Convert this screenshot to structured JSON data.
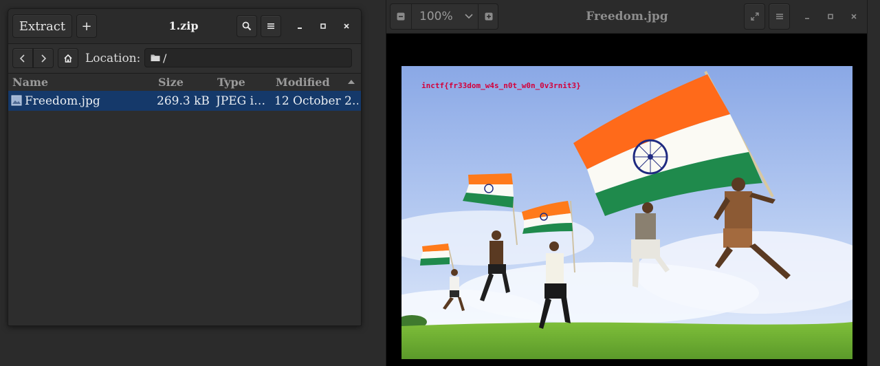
{
  "archive": {
    "title": "1.zip",
    "extract_label": "Extract",
    "add_label": "+",
    "location_label": "Location:",
    "location_path": "/",
    "columns": [
      "Name",
      "Size",
      "Type",
      "Modified"
    ],
    "files": [
      {
        "name": "Freedom.jpg",
        "size": "269.3 kB",
        "type": "JPEG i…",
        "modified": "12 October 2…"
      }
    ]
  },
  "viewer": {
    "title": "Freedom.jpg",
    "zoom": "100%",
    "image_text": "inctf{fr33dom_w4s_n0t_w0n_0v3rnit3}"
  },
  "colors": {
    "selection": "#15396a",
    "flag_text": "#d4003a",
    "saffron": "#ff7a1a",
    "green": "#1f8a4c",
    "chakra": "#1f2a80"
  }
}
